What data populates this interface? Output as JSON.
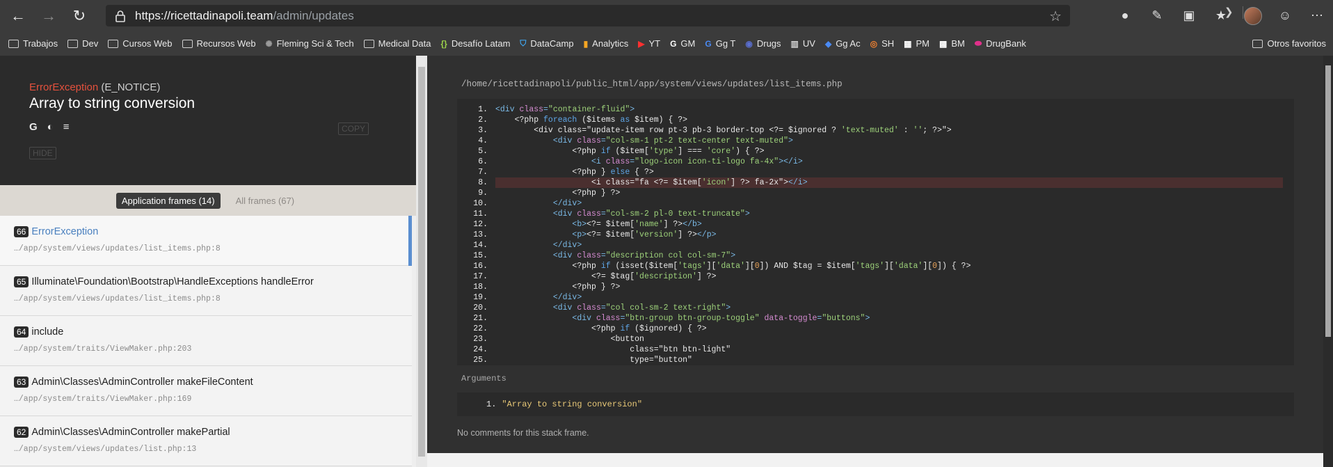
{
  "browser": {
    "url_host": "https://ricettadinapoli.team",
    "url_path": "/admin/updates",
    "bookmarks": [
      {
        "label": "Trabajos",
        "icon": "folder-icon"
      },
      {
        "label": "Dev",
        "icon": "folder-icon"
      },
      {
        "label": "Cursos Web",
        "icon": "folder-icon"
      },
      {
        "label": "Recursos Web",
        "icon": "folder-icon"
      },
      {
        "label": "Fleming Sci & Tech",
        "icon": "gear-icon"
      },
      {
        "label": "Medical Data",
        "icon": "folder-icon"
      },
      {
        "label": "Desafío Latam",
        "icon": "braces-icon"
      },
      {
        "label": "DataCamp",
        "icon": "shield-icon"
      },
      {
        "label": "Analytics",
        "icon": "bar-chart-icon"
      },
      {
        "label": "YT",
        "icon": "youtube-icon"
      },
      {
        "label": "GM",
        "icon": "google-icon"
      },
      {
        "label": "Gg T",
        "icon": "translate-icon"
      },
      {
        "label": "Drugs",
        "icon": "drugs-icon"
      },
      {
        "label": "UV",
        "icon": "uv-icon"
      },
      {
        "label": "Gg Ac",
        "icon": "ads-icon"
      },
      {
        "label": "SH",
        "icon": "eye-icon"
      },
      {
        "label": "PM",
        "icon": "pm-icon"
      },
      {
        "label": "BM",
        "icon": "bm-icon"
      },
      {
        "label": "DrugBank",
        "icon": "pill-icon"
      }
    ],
    "other_favorites": "Otros favoritos"
  },
  "error": {
    "type": "ErrorException",
    "notice": " (E_NOTICE)",
    "message": "Array to string conversion",
    "copy_label": "COPY",
    "hide_label": "HIDE"
  },
  "tabs": {
    "app_frames": "Application frames (14)",
    "all_frames": "All frames (67)"
  },
  "frames": [
    {
      "num": "66",
      "class": "ErrorException",
      "file": "…/app/system/views/updates/list_items.php:8"
    },
    {
      "num": "65",
      "class": "Illuminate\\Foundation\\Bootstrap\\HandleExceptions handleError",
      "file": "…/app/system/views/updates/list_items.php:8"
    },
    {
      "num": "64",
      "class": "include",
      "file": "…/app/system/traits/ViewMaker.php:203"
    },
    {
      "num": "63",
      "class": "Admin\\Classes\\AdminController makeFileContent",
      "file": "…/app/system/traits/ViewMaker.php:169"
    },
    {
      "num": "62",
      "class": "Admin\\Classes\\AdminController makePartial",
      "file": "…/app/system/views/updates/list.php:13"
    }
  ],
  "code": {
    "path": "/home/ricettadinapoli/public_html/app/system/views/updates/list_items.php",
    "line_numbers": [
      "1.",
      "2.",
      "3.",
      "4.",
      "5.",
      "6.",
      "7.",
      "8.",
      "9.",
      "10.",
      "11.",
      "12.",
      "13.",
      "14.",
      "15.",
      "16.",
      "17.",
      "18.",
      "19.",
      "20.",
      "21.",
      "22.",
      "23.",
      "24.",
      "25."
    ],
    "highlight_line": 8
  },
  "arguments": {
    "title": "Arguments",
    "num": "1.",
    "value": "\"Array to string conversion\""
  },
  "comments": "No comments for this stack frame."
}
